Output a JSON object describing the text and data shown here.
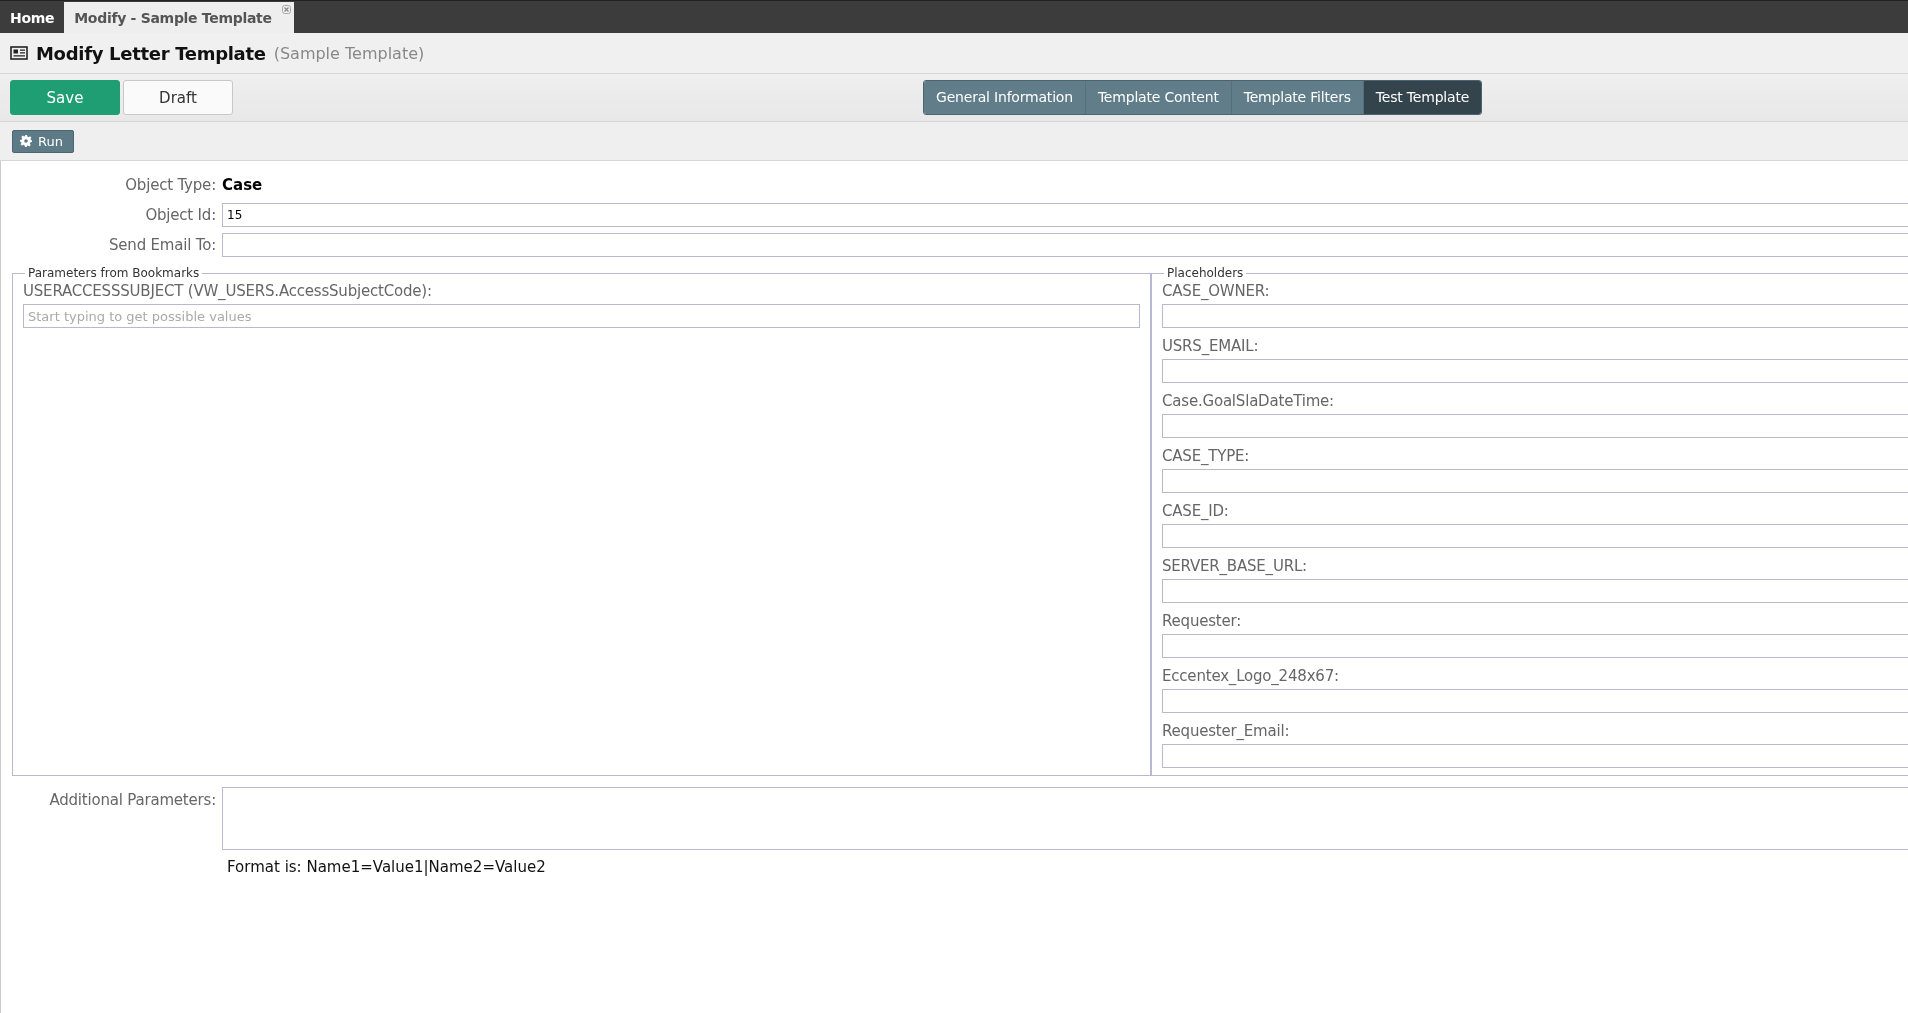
{
  "top_tabs": [
    {
      "label": "Home",
      "selected": false,
      "closable": false
    },
    {
      "label": "Modify - Sample Template",
      "selected": true,
      "closable": true
    }
  ],
  "header": {
    "title": "Modify Letter Template",
    "subtitle": "(Sample Template)"
  },
  "toolbar": {
    "buttons": [
      {
        "label": "Save",
        "kind": "primary"
      },
      {
        "label": "Draft",
        "kind": "default"
      }
    ],
    "tabs": [
      {
        "label": "General Information",
        "selected": false
      },
      {
        "label": "Template Content",
        "selected": false
      },
      {
        "label": "Template Filters",
        "selected": false
      },
      {
        "label": "Test Template",
        "selected": true
      }
    ]
  },
  "run_button": {
    "label": "Run"
  },
  "form": {
    "object_type": {
      "label": "Object Type:",
      "value": "Case"
    },
    "object_id": {
      "label": "Object Id:",
      "value": "15"
    },
    "send_email": {
      "label": "Send Email To:"
    }
  },
  "bookmarks": {
    "legend": "Parameters from Bookmarks",
    "fields": [
      {
        "label": "USERACCESSSUBJECT (VW_USERS.AccessSubjectCode):",
        "placeholder": "Start typing to get possible values"
      }
    ]
  },
  "placeholders": {
    "legend": "Placeholders",
    "fields": [
      {
        "label": "CASE_OWNER:"
      },
      {
        "label": "USRS_EMAIL:"
      },
      {
        "label": "Case.GoalSlaDateTime:"
      },
      {
        "label": "CASE_TYPE:"
      },
      {
        "label": "CASE_ID:"
      },
      {
        "label": "SERVER_BASE_URL:"
      },
      {
        "label": "Requester:"
      },
      {
        "label": "Eccentex_Logo_248x67:"
      },
      {
        "label": "Requester_Email:"
      }
    ]
  },
  "additional": {
    "label": "Additional Parameters:",
    "hint": "Format is: Name1=Value1|Name2=Value2"
  }
}
